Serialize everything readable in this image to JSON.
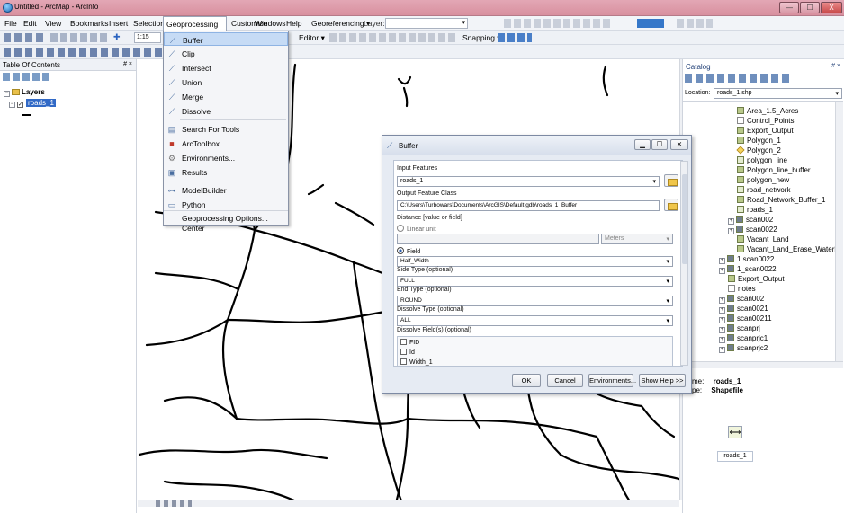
{
  "window": {
    "title": "Untitled - ArcMap - ArcInfo",
    "min": "—",
    "max": "☐",
    "close": "X"
  },
  "menubar": [
    "File",
    "Edit",
    "View",
    "Bookmarks",
    "Insert",
    "Selection",
    "Geoprocessing",
    "Customize",
    "Windows",
    "Help"
  ],
  "toolbar": {
    "scale": "1:15",
    "georef_label": "Georeferencing ▾",
    "layer_label": "Layer:",
    "editor_label": "Editor ▾",
    "snapping_label": "Snapping ▾"
  },
  "geoprocessing_menu": {
    "items": [
      {
        "label": "Buffer",
        "icon": "buffer-tool-icon"
      },
      {
        "label": "Clip",
        "icon": "clip-tool-icon"
      },
      {
        "label": "Intersect",
        "icon": "intersect-tool-icon"
      },
      {
        "label": "Union",
        "icon": "union-tool-icon"
      },
      {
        "label": "Merge",
        "icon": "merge-tool-icon"
      },
      {
        "label": "Dissolve",
        "icon": "dissolve-tool-icon"
      },
      {
        "label": "Search For Tools",
        "icon": "search-tools-icon"
      },
      {
        "label": "ArcToolbox",
        "icon": "arctoolbox-icon"
      },
      {
        "label": "Environments...",
        "icon": "environments-icon"
      },
      {
        "label": "Results",
        "icon": "results-icon"
      },
      {
        "label": "ModelBuilder",
        "icon": "modelbuilder-icon"
      },
      {
        "label": "Python",
        "icon": "python-icon"
      },
      {
        "label": "Geoprocessing Resource Center",
        "icon": "resource-center-icon"
      },
      {
        "label": "Geoprocessing Options...",
        "icon": ""
      }
    ]
  },
  "toc": {
    "title": "Table Of Contents",
    "pin": "# ×",
    "root": "Layers",
    "layer": "roads_1"
  },
  "buffer_dialog": {
    "title": "Buffer",
    "input_features_label": "Input Features",
    "input_features_value": "roads_1",
    "output_label": "Output Feature Class",
    "output_value": "C:\\Users\\Turbowars\\Documents\\ArcGIS\\Default.gdb\\roads_1_Buffer",
    "distance_label": "Distance [value or field]",
    "linear_unit_label": "Linear unit",
    "units_value": "Meters",
    "field_label": "Field",
    "field_value": "Half_Width",
    "side_type_label": "Side Type (optional)",
    "side_type_value": "FULL",
    "end_type_label": "End Type (optional)",
    "end_type_value": "ROUND",
    "dissolve_type_label": "Dissolve Type (optional)",
    "dissolve_type_value": "ALL",
    "dissolve_fields_label": "Dissolve Field(s) (optional)",
    "dissolve_fields": [
      "FID",
      "Id",
      "Width_1"
    ],
    "ok": "OK",
    "cancel": "Cancel",
    "environments": "Environments...",
    "show_help": "Show Help >>"
  },
  "catalog": {
    "title": "Catalog",
    "pin": "# ×",
    "location_label": "Location:",
    "location_value": "roads_1.shp",
    "items": [
      "Area_1.5_Acres",
      "Control_Points",
      "Export_Output",
      "Polygon_1",
      "Polygon_2",
      "polygon_line",
      "Polygon_line_buffer",
      "polygon_new",
      "road_network",
      "Road_Network_Buffer_1",
      "roads_1",
      "scan002",
      "scan0022",
      "Vacant_Land",
      "Vacant_Land_Erase_Waterbodi",
      "1.scan0022",
      "1_scan0022",
      "Export_Output",
      "notes",
      "scan002",
      "scan0021",
      "scan00211",
      "scanprj",
      "scanprjc1",
      "scanprjc2"
    ],
    "preview_name_label": "me:",
    "preview_name_value": "roads_1",
    "preview_type_label": "pe:",
    "preview_type_value": "Shapefile",
    "preview_caption": "roads_1"
  }
}
